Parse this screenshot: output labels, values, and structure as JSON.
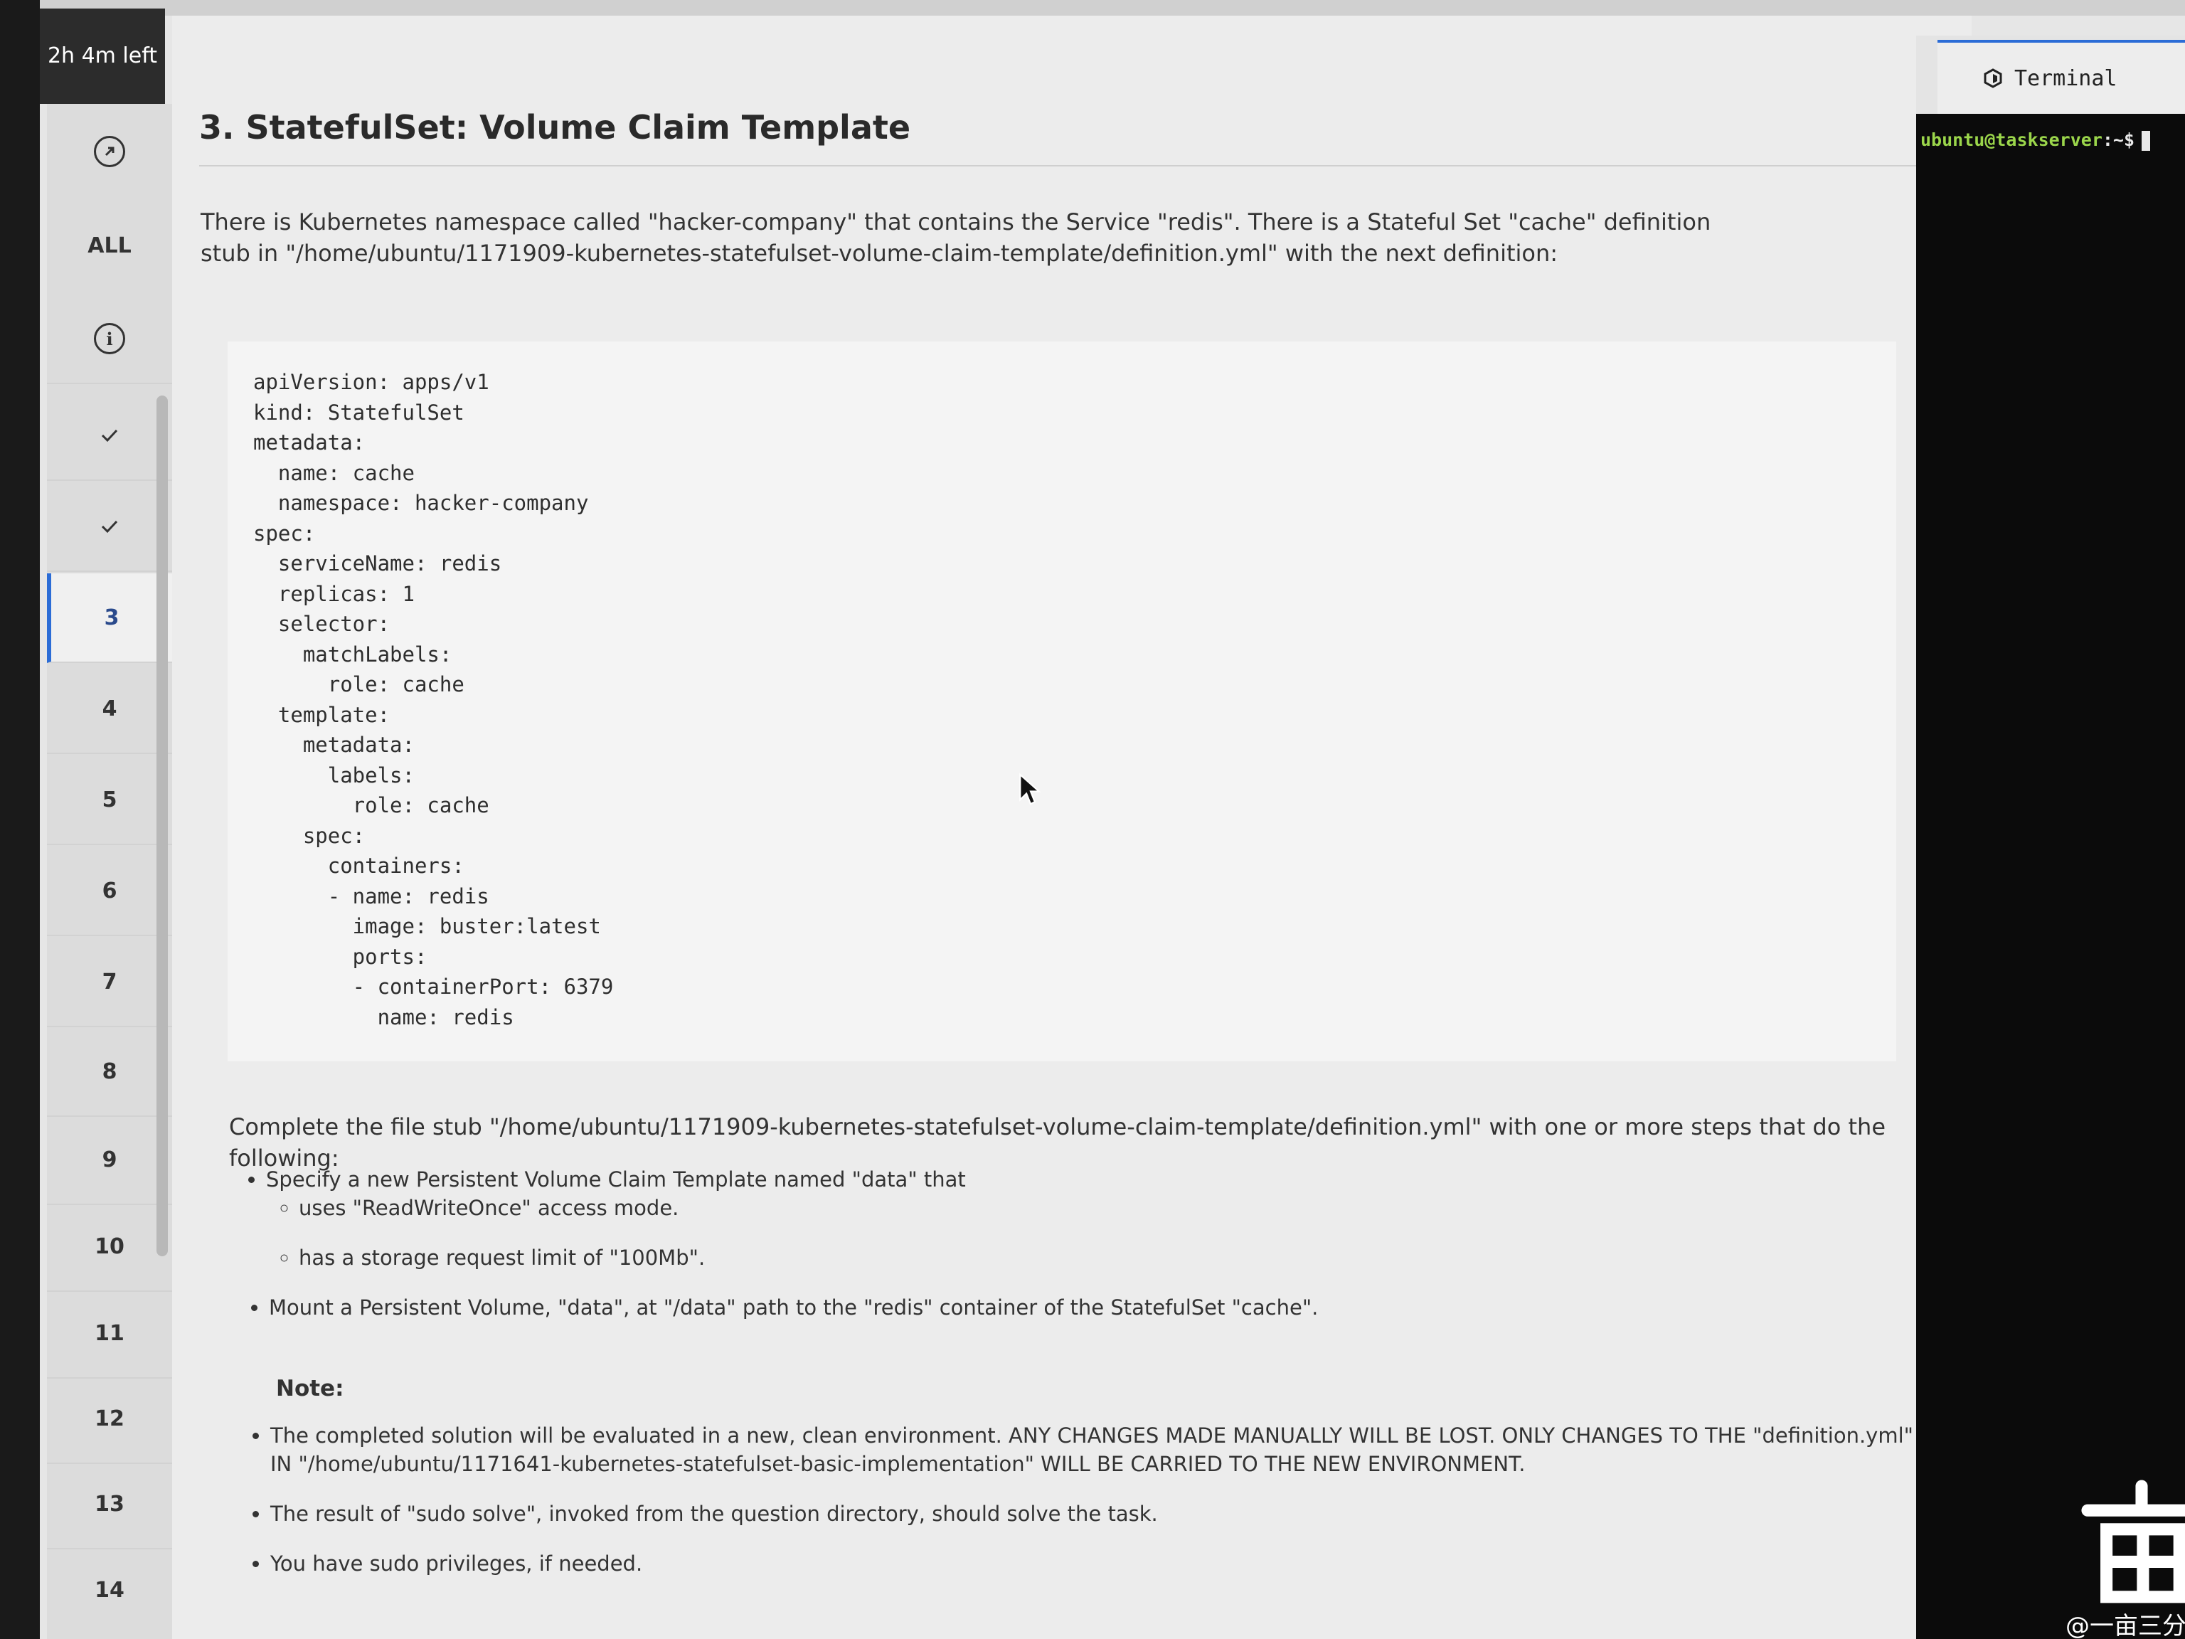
{
  "timer": {
    "label": "2h 4m left"
  },
  "rail": {
    "all_label": "ALL",
    "question_numbers": [
      "3",
      "4",
      "5",
      "6",
      "7",
      "8",
      "9",
      "10",
      "11",
      "12",
      "13",
      "14"
    ],
    "active": "3"
  },
  "question": {
    "title": "3. StatefulSet: Volume Claim Template",
    "intro": "There is Kubernetes namespace called \"hacker-company\" that contains the Service \"redis\".  There is a Stateful Set \"cache\" definition stub in \"/home/ubuntu/1171909-kubernetes-statefulset-volume-claim-template/definition.yml\" with the next definition:",
    "code": "apiVersion: apps/v1\nkind: StatefulSet\nmetadata:\n  name: cache\n  namespace: hacker-company\nspec:\n  serviceName: redis\n  replicas: 1\n  selector:\n    matchLabels:\n      role: cache\n  template:\n    metadata:\n      labels:\n        role: cache\n    spec:\n      containers:\n      - name: redis\n        image: buster:latest\n        ports:\n        - containerPort: 6379\n          name: redis",
    "complete_text": "Complete the file stub \"/home/ubuntu/1171909-kubernetes-statefulset-volume-claim-template/definition.yml\" with one or more steps that do the following:",
    "task1": "Specify a new Persistent Volume Claim Template named \"data\" that",
    "task1_sub1": "uses \"ReadWriteOnce\" access mode.",
    "task1_sub2": "has a storage request limit of \"100Mb\".",
    "task2": "Mount a Persistent Volume, \"data\", at \"/data\" path to the \"redis\" container of the StatefulSet \"cache\".",
    "note_label": "Note:",
    "note1": "The completed solution will be evaluated in a new, clean environment. ANY CHANGES MADE MANUALLY WILL BE LOST. ONLY CHANGES TO THE \"definition.yml\" FILE IN \"/home/ubuntu/1171641-kubernetes-statefulset-basic-implementation\" WILL BE CARRIED TO THE NEW ENVIRONMENT.",
    "note2": "The result of \"sudo solve\", invoked from the question directory, should solve the task.",
    "note3": "You have sudo privileges, if needed."
  },
  "terminal": {
    "tab_label": "Terminal",
    "prompt_user": "ubuntu@taskserver",
    "prompt_rest": ":~$"
  },
  "watermark": {
    "text": "@一亩三分地"
  },
  "colors": {
    "accent": "#2b6cd6",
    "prompt_green": "#9bd64b",
    "terminal_bg": "#0b0b0b"
  },
  "icons": [
    "expand-icon",
    "info-icon",
    "check-icon",
    "terminal-icon",
    "pointer-cursor-icon"
  ]
}
